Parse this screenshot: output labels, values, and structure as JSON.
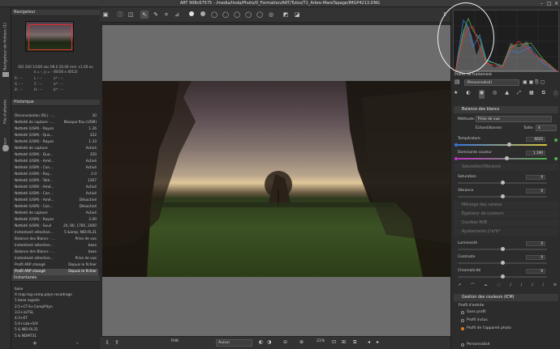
{
  "window": {
    "title": "ART 908c67575 - /media/linda/Photo/0_Formation/ART/Tutos/T1_Arbre-MareTapage/IMGP4213.DNG"
  },
  "vtabs": {
    "filebrowser": "Navigateur de fichiers (1)",
    "queue": "File d'attente",
    "editor": "Éditeur"
  },
  "navigator": {
    "title": "Navigateur",
    "exif": "ISO 200  1/100 sec  f/8.0  20.00 mm  +1.00 ev",
    "dims": "x = -, y = -   (6016 x 4012)",
    "rows": [
      [
        "R : --",
        "L : --",
        "x* : --"
      ],
      [
        "G : --",
        "C : --",
        "a* : --"
      ],
      [
        "B : --",
        "H : --",
        "b* : --"
      ]
    ]
  },
  "history": {
    "title": "Historique",
    "rows": [
      [
        "Déconvolution (RL) - ...",
        "30"
      ],
      [
        "Netteté de capture - ...",
        "Masque flou (USM)"
      ],
      [
        "Netteté (USM) - Rayon",
        "1.26"
      ],
      [
        "Netteté (USM) - Qua...",
        "322"
      ],
      [
        "Netteté (USM) - Rayon",
        "1.33"
      ],
      [
        "Netteté de capture",
        "Activé"
      ],
      [
        "Netteté (USM) - Qua...",
        "350"
      ],
      [
        "Netteté (USM) - Amé...",
        "Activé"
      ],
      [
        "Netteté (USM) - Con...",
        "Activé"
      ],
      [
        "Netteté (USM) - Ray...",
        "2.0"
      ],
      [
        "Netteté (USM) - Tolé...",
        "1267"
      ],
      [
        "Netteté (USM) - Amé...",
        "Activé"
      ],
      [
        "Netteté (USM) - Con...",
        "Activé"
      ],
      [
        "Netteté (USM) - Amé...",
        "Désactivé"
      ],
      [
        "Netteté (USM) - Con...",
        "Désactivé"
      ],
      [
        "Netteté de capture",
        "Activé"
      ],
      [
        "Netteté (USM) - Rayon",
        "2.00"
      ],
      [
        "Netteté (USM) - Seuil",
        "20, 80, 1785, 2000"
      ],
      [
        "Instantané sélection...",
        "5 &amp; NID-RL31"
      ],
      [
        "Balance des Blancs - ...",
        "Prise de vue"
      ],
      [
        "Instantané sélection...",
        "base"
      ],
      [
        "Balance des Blancs - ...",
        "base"
      ],
      [
        "Instantané sélection...",
        "Prise de vue"
      ],
      [
        "Profil ARP changé",
        "Depuis le fichier"
      ],
      [
        "Profil ARP changé",
        "Depuis le fichier"
      ]
    ],
    "selected_index": 24
  },
  "snapshots": {
    "title": "Instantanés",
    "items": [
      "base",
      "X map-log-comp.pdyn-recadrage",
      "1 base rognée",
      "2:1+CT-S+CompPdyn",
      "3:2+iniTSL",
      "4:3+ET",
      "5:4+Lab+S/V",
      "5 & NID-RL31",
      "5 & NDMT31"
    ],
    "add": "+",
    "remove": "-"
  },
  "bottom": {
    "status": "Prêt",
    "combo1": "Aucun",
    "zoom": "21%",
    "profile": "Aucun"
  },
  "right": {
    "profile_label": "Profils de traitement",
    "profile_value": "(Personnalisé)",
    "wb": {
      "title": "Balance des blancs",
      "method_label": "Méthode:",
      "method_value": "Prise de vue",
      "sample": "Échantillonner",
      "size_label": "Taille:",
      "size_value": "4",
      "temp_label": "Température",
      "temp_value": "6020",
      "temp_frac": 0.58,
      "tint_label": "Dominante couleur",
      "tint_value": "1.190",
      "tint_frac": 0.55
    },
    "sv": {
      "title": "Saturation/Vibrance",
      "sat_label": "Saturation",
      "sat_value": "0",
      "vib_label": "Vibrance",
      "vib_value": "0"
    },
    "dim_sections": [
      "Mélange des canaux",
      "Égaliseur de couleurs",
      "Courbes RVB",
      "Ajustements L*a*b*"
    ],
    "lab": {
      "lum_label": "Luminosité",
      "lum_value": "0",
      "con_label": "Contraste",
      "con_value": "0",
      "chr_label": "Chromaticité",
      "chr_value": "0"
    },
    "icm": {
      "title": "Gestion des couleurs (ICM)",
      "input_label": "Profil d'entrée",
      "options": [
        "Sans profil",
        "Profil inclus",
        "Profil de l'appareil photo",
        "Personnalisé"
      ],
      "selected": 2
    }
  },
  "colors": {
    "accent": "#e23030",
    "dot_green": "#4caf50",
    "dot_magenta": "#c236c2",
    "dot_blue": "#3c78d8",
    "dot_yellow": "#d8c43c"
  }
}
